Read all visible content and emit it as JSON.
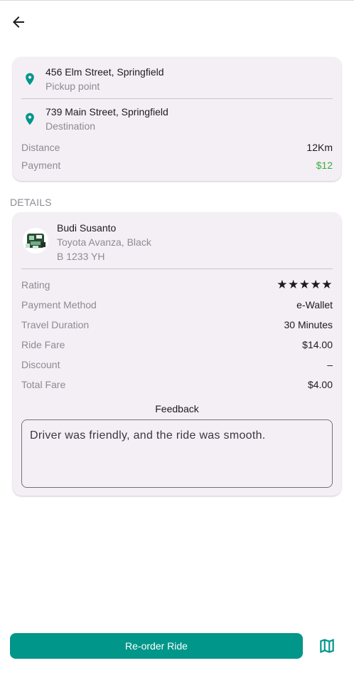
{
  "trip": {
    "pickup_address": "456 Elm Street, Springfield",
    "pickup_label": "Pickup point",
    "destination_address": "739 Main Street, Springfield",
    "destination_label": "Destination",
    "distance_label": "Distance",
    "distance_value": "12Km",
    "payment_label": "Payment",
    "payment_value": "$12"
  },
  "details": {
    "section_title": "DETAILS",
    "driver_name": "Budi Susanto",
    "car": "Toyota Avanza, Black",
    "plate": "B 1233 YH",
    "rows": [
      {
        "label": "Rating",
        "value": "★★★★★"
      },
      {
        "label": "Payment Method",
        "value": "e-Wallet"
      },
      {
        "label": "Travel Duration",
        "value": "30 Minutes"
      },
      {
        "label": "Ride Fare",
        "value": "$14.00"
      },
      {
        "label": "Discount",
        "value": "–"
      },
      {
        "label": "Total Fare",
        "value": "$4.00"
      }
    ],
    "rating": 5,
    "feedback_title": "Feedback",
    "feedback_text": "Driver was friendly, and the ride was smooth."
  },
  "actions": {
    "reorder_label": "Re-order Ride"
  },
  "icons": {
    "back": "arrow-left-icon",
    "pin": "location-pin-icon",
    "map": "map-icon"
  },
  "colors": {
    "accent": "#00968a",
    "payment_green": "#3cab3f",
    "card_bg": "#f4eff5"
  }
}
